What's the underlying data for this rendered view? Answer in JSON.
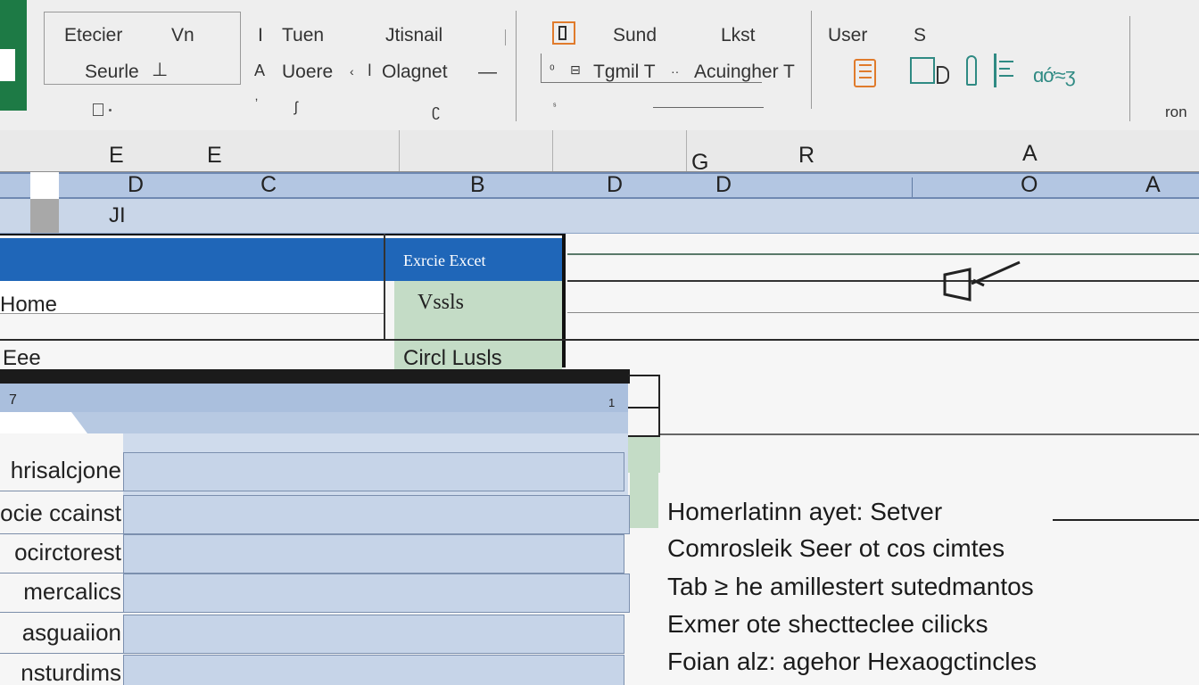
{
  "ribbon": {
    "font_group": {
      "line1_a": "Etecier",
      "line1_b": "Vn",
      "line2": "Seurle",
      "line2_mark": "⊥"
    },
    "align_group": {
      "line1_a": "I",
      "line1_b": "Tuen",
      "line1_c": "Jtisnail",
      "line2_a": "Uoere",
      "line2_b": "Olagnet",
      "line2_dash": "—"
    },
    "styles_group": {
      "label_a": "Sund",
      "label_b": "Lkst",
      "label_c": "Tgmil T",
      "label_d": "Acuingher T"
    },
    "user_group": {
      "label_user": "User",
      "label_s": "S"
    },
    "right_cut": "ron"
  },
  "columns": {
    "row1": [
      "E",
      "E",
      "G",
      "R",
      "A"
    ],
    "row2": [
      "D",
      "C",
      "B",
      "D",
      "D",
      "O",
      "A"
    ],
    "row3": "JI"
  },
  "sheet": {
    "panel_header": "Exrcie Excet",
    "home_label": "Home",
    "ee_label": "Eee",
    "vssls": "Vssls",
    "circl": "Circl Lusls",
    "list_header_num_left": "7",
    "list_header_num_right": "1",
    "list_rows": [
      "hrisalcjone",
      "ocie ccainst",
      "ocirctorest",
      "mercalics",
      "asguaiion",
      "nsturdims"
    ]
  },
  "notes": [
    "Homerlatinn ayet: Setver",
    "Comrosleik Seer ot cos cimtes",
    "Tab ≥ he amillestert sutedmantos",
    "Exmer ote  shectteclee cilicks",
    "Foian  alz: agehor Hexaogctincles"
  ],
  "colors": {
    "excel_green": "#1d7a45",
    "header_blue": "#1f66b8",
    "accent_green": "#c4dcc6",
    "row_blue": "#c6d4e8",
    "icon_orange": "#e07b2c",
    "icon_teal": "#2f8a83"
  },
  "icons": [
    "sheet-icon",
    "paint-icon",
    "clipboard-icon",
    "table-icon",
    "column-icon",
    "list-icon",
    "share-icon",
    "cursor-arrow-icon"
  ]
}
